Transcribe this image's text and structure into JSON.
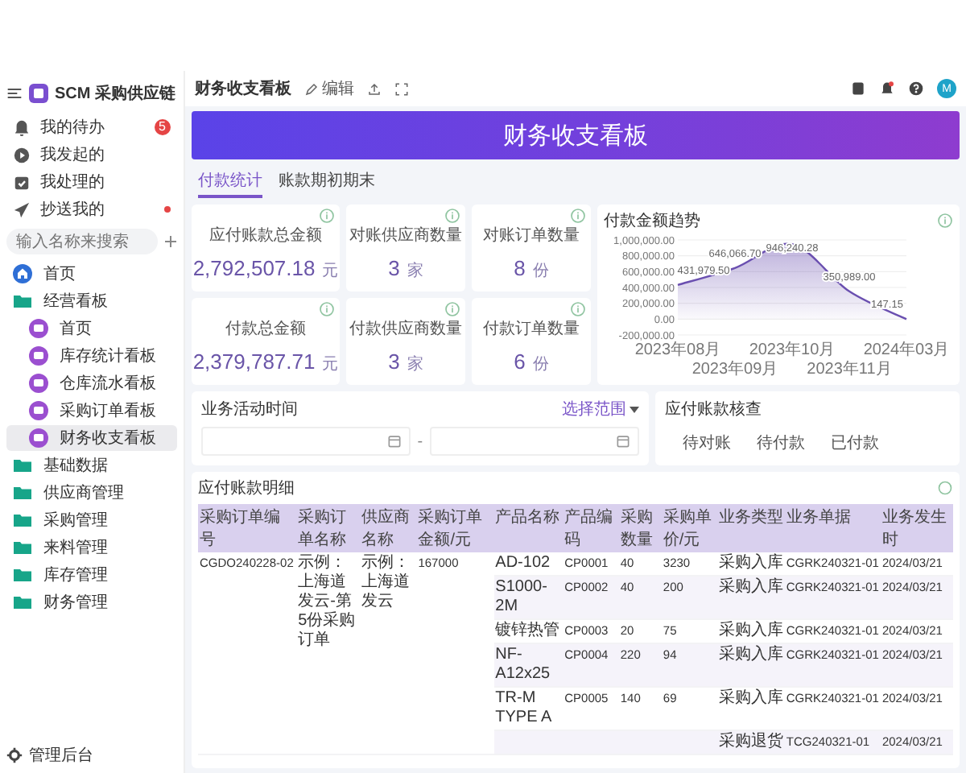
{
  "app": {
    "name": "SCM 采购供应链"
  },
  "quick_links": [
    {
      "label": "我的待办",
      "kind": "todo",
      "badge": "5"
    },
    {
      "label": "我发起的",
      "kind": "started"
    },
    {
      "label": "我处理的",
      "kind": "handled"
    },
    {
      "label": "抄送我的",
      "kind": "cc",
      "unread": true
    }
  ],
  "search": {
    "placeholder": "输入名称来搜索"
  },
  "nav": [
    {
      "label": "首页",
      "kind": "home",
      "selected": false
    },
    {
      "label": "经营看板",
      "kind": "folder",
      "selected": false,
      "children": [
        {
          "label": "首页",
          "kind": "board",
          "selected": false
        },
        {
          "label": "库存统计看板",
          "kind": "board",
          "selected": false
        },
        {
          "label": "仓库流水看板",
          "kind": "board",
          "selected": false
        },
        {
          "label": "采购订单看板",
          "kind": "board",
          "selected": false
        },
        {
          "label": "财务收支看板",
          "kind": "board",
          "selected": true
        }
      ]
    },
    {
      "label": "基础数据",
      "kind": "folder",
      "selected": false
    },
    {
      "label": "供应商管理",
      "kind": "folder",
      "selected": false
    },
    {
      "label": "采购管理",
      "kind": "folder",
      "selected": false
    },
    {
      "label": "来料管理",
      "kind": "folder",
      "selected": false
    },
    {
      "label": "库存管理",
      "kind": "folder",
      "selected": false
    },
    {
      "label": "财务管理",
      "kind": "folder",
      "selected": false
    }
  ],
  "sidebar_footer": {
    "label": "管理后台"
  },
  "topbar": {
    "title": "财务收支看板",
    "edit": "编辑",
    "avatar": "M"
  },
  "banner": {
    "title": "财务收支看板"
  },
  "tabs": [
    {
      "label": "付款统计",
      "selected": true
    },
    {
      "label": "账款期初期末",
      "selected": false
    }
  ],
  "kpis": [
    {
      "label": "应付账款总金额",
      "value": "2,792,507.18",
      "unit": "元"
    },
    {
      "label": "对账供应商数量",
      "value": "3",
      "unit": "家"
    },
    {
      "label": "对账订单数量",
      "value": "8",
      "unit": "份"
    },
    {
      "label": "付款总金额",
      "value": "2,379,787.71",
      "unit": "元"
    },
    {
      "label": "付款供应商数量",
      "value": "3",
      "unit": "家"
    },
    {
      "label": "付款订单数量",
      "value": "6",
      "unit": "份"
    }
  ],
  "trend": {
    "title": "付款金额趋势",
    "chart_data": {
      "type": "area",
      "categories": [
        "2023年08月",
        "2023年09月",
        "2023年10月",
        "2023年11月",
        "2024年03月"
      ],
      "series": [
        {
          "color": "#6a4fb0",
          "values": [
            431979.5,
            646066.7,
            946240.28,
            350989,
            147.15
          ]
        }
      ],
      "grid": true,
      "ylim": [
        -200000,
        1000000
      ],
      "yticks": [
        {
          "value": -200000,
          "label": "-200,000.00"
        },
        {
          "value": 0,
          "label": "0.00"
        },
        {
          "value": 200000,
          "label": "200,000.00"
        },
        {
          "value": 400000,
          "label": "400,000.00"
        },
        {
          "value": 600000,
          "label": "600,000.00"
        },
        {
          "value": 800000,
          "label": "800,000.00"
        },
        {
          "value": 1000000,
          "label": "1,000,000.00"
        }
      ],
      "value_labels": [
        "431,979.50",
        "646,066.70",
        "946,240.28",
        "350,989.00",
        "147.15"
      ]
    }
  },
  "filter": {
    "label": "业务活动时间",
    "range_button": "选择范围",
    "separator": "-"
  },
  "status_filter": {
    "label": "应付账款核查",
    "options": [
      {
        "label": "待对账",
        "selected": false
      },
      {
        "label": "待付款",
        "selected": false
      },
      {
        "label": "已付款",
        "selected": false
      }
    ]
  },
  "table": {
    "title": "应付账款明细",
    "columns": [
      "采购订单编号",
      "采购订单名称",
      "供应商名称",
      "采购订单金额/元",
      "产品名称",
      "产品编码",
      "采购数量",
      "采购单价/元",
      "业务类型",
      "业务单据",
      "业务发生时"
    ],
    "orders": [
      {
        "number": "CGDO240228-02",
        "name": "示例：上海道发云-第5份采购订单",
        "supplier": "示例：上海道发云",
        "amount": "167000",
        "items": [
          {
            "product": "AD-102",
            "code": "CP0001",
            "qty": "40",
            "price": "3230",
            "type": "采购入库",
            "doc": "CGRK240321-01",
            "date": "2024/03/21"
          },
          {
            "product": "S1000-2M",
            "code": "CP0002",
            "qty": "40",
            "price": "200",
            "type": "采购入库",
            "doc": "CGRK240321-01",
            "date": "2024/03/21"
          },
          {
            "product": "镀锌热管",
            "code": "CP0003",
            "qty": "20",
            "price": "75",
            "type": "采购入库",
            "doc": "CGRK240321-01",
            "date": "2024/03/21"
          },
          {
            "product": "NF-A12x25",
            "code": "CP0004",
            "qty": "220",
            "price": "94",
            "type": "采购入库",
            "doc": "CGRK240321-01",
            "date": "2024/03/21"
          },
          {
            "product": "TR-M TYPE A",
            "code": "CP0005",
            "qty": "140",
            "price": "69",
            "type": "采购入库",
            "doc": "CGRK240321-01",
            "date": "2024/03/21"
          },
          {
            "type": "采购退货",
            "doc": "TCG240321-01",
            "date": "2024/03/21"
          }
        ]
      }
    ]
  }
}
